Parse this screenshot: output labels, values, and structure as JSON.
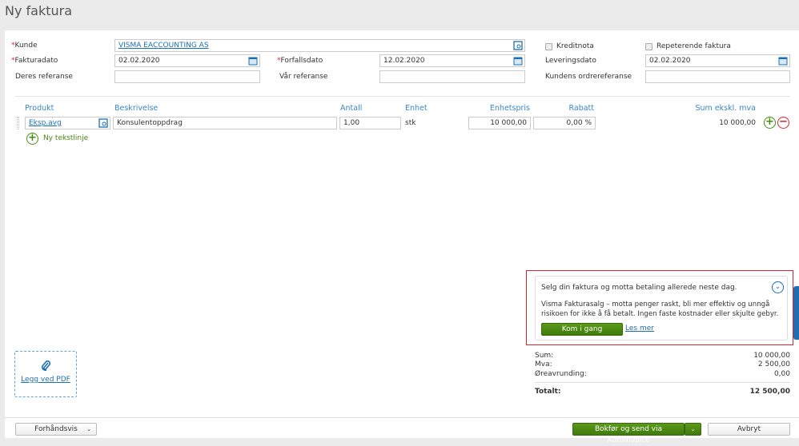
{
  "page": {
    "title": "Ny faktura"
  },
  "form": {
    "kunde_label": "Kunde",
    "kunde_value": "VISMA EACCOUNTING AS",
    "fakturadato_label": "Fakturadato",
    "fakturadato_value": "02.02.2020",
    "forfallsdato_label": "Forfallsdato",
    "forfallsdato_value": "12.02.2020",
    "leveringsdato_label": "Leveringsdato",
    "leveringsdato_value": "02.02.2020",
    "deres_ref_label": "Deres referanse",
    "deres_ref_value": "",
    "var_ref_label": "Vår referanse",
    "var_ref_value": "",
    "kundens_ref_label": "Kundens ordrereferanse",
    "kundens_ref_value": "",
    "kreditnota_label": "Kreditnota",
    "kreditnota_checked": false,
    "repeterende_label": "Repeterende faktura",
    "repeterende_checked": false
  },
  "lines": {
    "headers": {
      "produkt": "Produkt",
      "beskrivelse": "Beskrivelse",
      "antall": "Antall",
      "enhet": "Enhet",
      "enhetspris": "Enhetspris",
      "rabatt": "Rabatt",
      "sum": "Sum ekskl. mva"
    },
    "rows": [
      {
        "produkt": "Eksp.avg",
        "beskrivelse": "Konsulentoppdrag",
        "antall": "1,00",
        "enhet": "stk",
        "enhetspris": "10 000,00",
        "rabatt": "0,00 %",
        "sum": "10 000,00"
      }
    ],
    "add_text_line": "Ny tekstlinje"
  },
  "promo": {
    "heading": "Selg din faktura og motta betaling allerede neste dag.",
    "body": "Visma Fakturasalg – motta penger raskt, bli mer effektiv og unngå risikoen for ikke å få betalt. Ingen faste kostnader eller skjulte gebyr.",
    "cta": "Kom i gang",
    "link": "Les mer"
  },
  "totals": {
    "sum_label": "Sum:",
    "sum": "10 000,00",
    "mva_label": "Mva:",
    "mva": "2 500,00",
    "ore_label": "Øreavrunding:",
    "ore": "0,00",
    "total_label": "Totalt:",
    "total": "12 500,00"
  },
  "attach": {
    "label": "Legg ved PDF"
  },
  "footer": {
    "preview": "Forhåndsvis",
    "post_send": "Bokfør og send via AutoInvoice",
    "cancel": "Avbryt"
  },
  "colors": {
    "accent": "#1a6fb5",
    "green": "#4a8a12",
    "red": "#d9252f"
  }
}
